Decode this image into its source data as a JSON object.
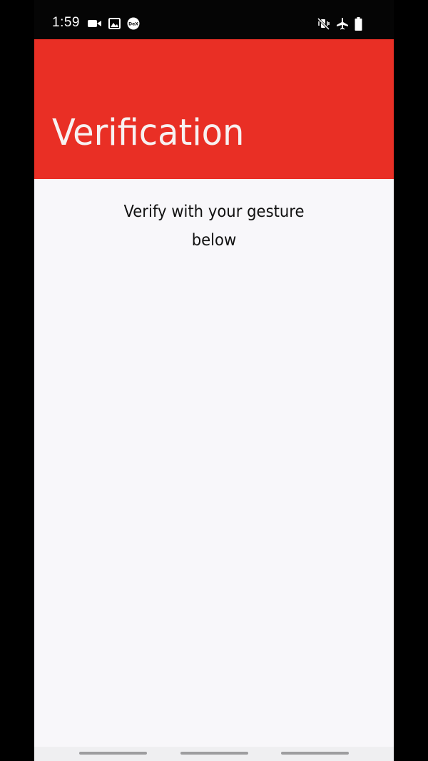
{
  "status_bar": {
    "time": "1:59",
    "left_icons": [
      "video-camera-icon",
      "gallery-icon",
      "dex-icon"
    ],
    "dex_label": "DeX",
    "right_icons": [
      "mute-vibrate-icon",
      "airplane-mode-icon",
      "battery-icon"
    ]
  },
  "header": {
    "title": "Verification",
    "background_color": "#e92f25"
  },
  "main": {
    "instruction_line1": "Verify with your gesture",
    "instruction_line2": "below"
  },
  "nav_bar": {
    "handles": 3
  }
}
